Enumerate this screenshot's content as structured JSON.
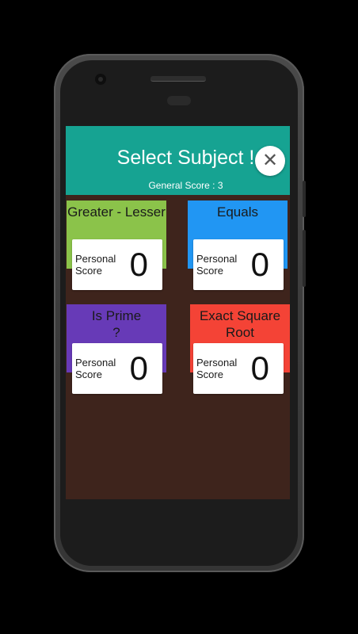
{
  "screen": {
    "title": "Select Subject !",
    "general_score": "General Score : 3",
    "close_icon": "✕"
  },
  "subjects": [
    {
      "title": "Greater - Lesser",
      "color": "#8bc34a",
      "personal_score_label": "Personal Score",
      "score": "0"
    },
    {
      "title": "Equals",
      "color": "#2196f3",
      "personal_score_label": "Personal Score",
      "score": "0"
    },
    {
      "title": "Is Prime ?",
      "color": "#673ab7",
      "personal_score_label": "Personal Score",
      "score": "0"
    },
    {
      "title": "Exact Square Root",
      "color": "#f44336",
      "personal_score_label": "Personal Score",
      "score": "0"
    }
  ],
  "colors": {
    "header": "#16a392",
    "background": "#3e241c"
  }
}
